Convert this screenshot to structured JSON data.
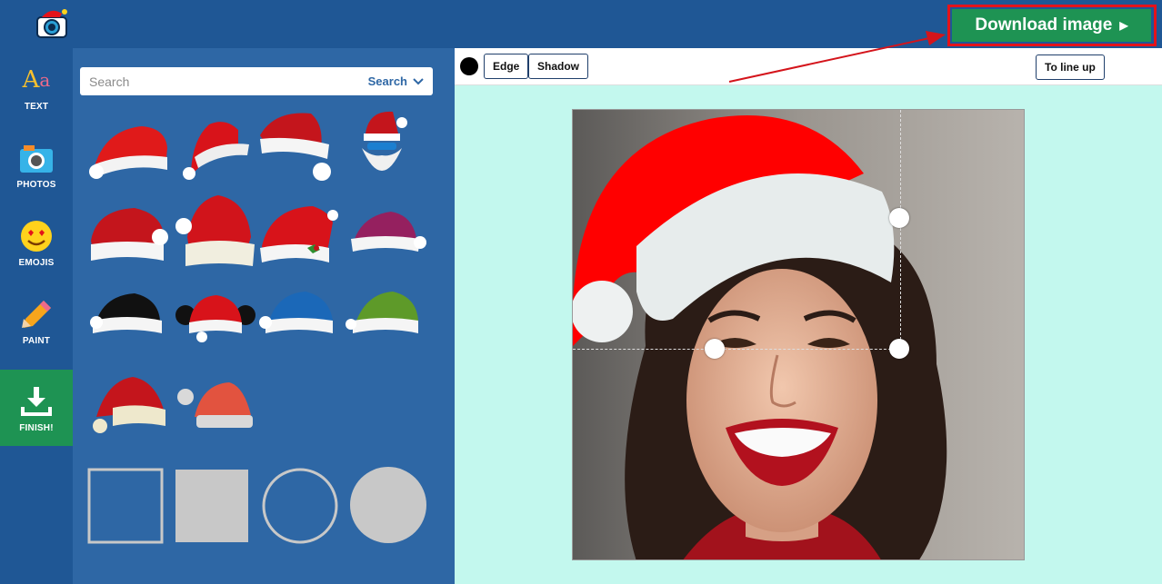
{
  "header": {
    "download_label": "Download image",
    "logo_icon": "camera-santa-logo-icon"
  },
  "rail": {
    "items": [
      {
        "label": "TEXT",
        "icon": "text-aa-icon"
      },
      {
        "label": "PHOTOS",
        "icon": "photo-camera-icon"
      },
      {
        "label": "EMOJIS",
        "icon": "heart-eyes-emoji-icon"
      },
      {
        "label": "PAINT",
        "icon": "pencil-icon"
      },
      {
        "label": "FINISH!",
        "icon": "download-icon",
        "active": true
      }
    ]
  },
  "panel": {
    "search_placeholder": "Search",
    "search_button": "Search",
    "stickers": [
      "santa-hat-1",
      "santa-hat-2",
      "santa-hat-3",
      "santa-hat-beard",
      "santa-hat-5",
      "santa-hat-6",
      "santa-hat-holly",
      "santa-hat-purple",
      "santa-hat-black",
      "santa-hat-mouse-ears",
      "santa-hat-blue",
      "santa-hat-green",
      "santa-hat-cream",
      "santa-hat-flat"
    ],
    "shapes": [
      "square-outline",
      "square-filled",
      "circle-outline",
      "circle-filled"
    ]
  },
  "toolbar": {
    "color_swatch": "#000000",
    "edge_label": "Edge",
    "shadow_label": "Shadow",
    "lineup_label": "To line up"
  },
  "colors": {
    "topbar": "#1f5795",
    "panel": "#2e67a5",
    "accent_green": "#1e9353",
    "canvas_bg": "#c3f8ee",
    "highlight_red": "#e4131a"
  }
}
